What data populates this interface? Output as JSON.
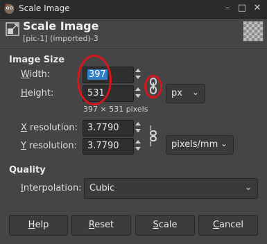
{
  "window": {
    "title": "Scale Image"
  },
  "header": {
    "title": "Scale Image",
    "subtitle": "[pic-1] (imported)-3"
  },
  "image_size": {
    "heading": "Image Size",
    "width_label_accel": "W",
    "width_label_rest": "idth:",
    "width_value": "397",
    "height_label_accel": "H",
    "height_label_rest": "eight:",
    "height_value": "531",
    "unit": "px",
    "pixel_info": "397 × 531 pixels",
    "xres_label_accel": "X",
    "xres_label_rest": " resolution:",
    "xres_value": "3.7790",
    "yres_label_accel": "Y",
    "yres_label_rest": " resolution:",
    "yres_value": "3.7790",
    "res_unit": "pixels/mm"
  },
  "quality": {
    "heading": "Quality",
    "interp_label_accel": "I",
    "interp_label_rest": "nterpolation:",
    "interp_value": "Cubic"
  },
  "buttons": {
    "help_accel": "H",
    "help_rest": "elp",
    "reset_accel": "R",
    "reset_rest": "eset",
    "scale_accel": "S",
    "scale_rest": "cale",
    "cancel_accel": "C",
    "cancel_rest": "ancel"
  },
  "colors": {
    "annotation": "#d8141c",
    "selection": "#2f80c8"
  },
  "icons": [
    "gimp-app-icon",
    "minimize-icon",
    "maximize-icon",
    "close-icon",
    "scale-image-icon",
    "chain-link-icon",
    "chain-broken-icon",
    "chevron-down-icon"
  ]
}
